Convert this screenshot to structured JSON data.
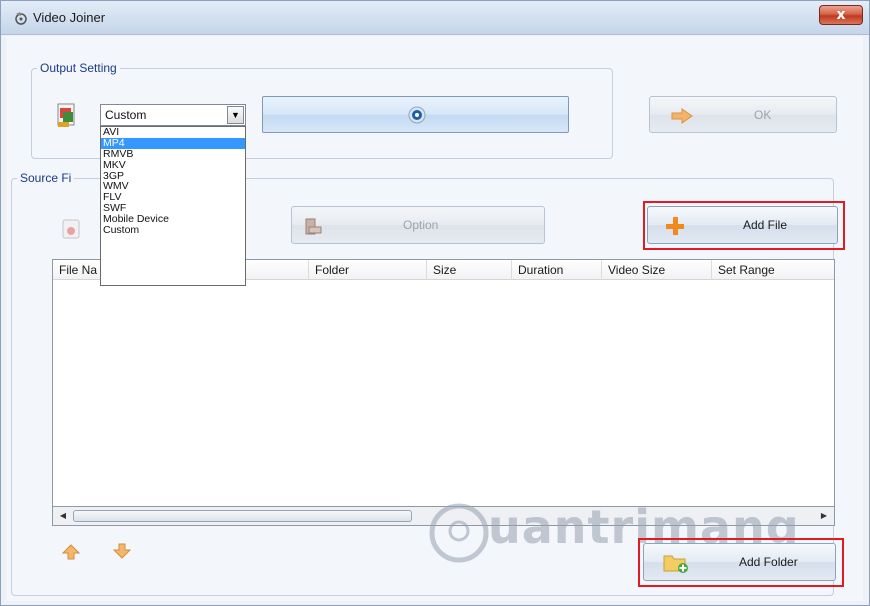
{
  "window": {
    "title": "Video Joiner",
    "close_label": "x"
  },
  "output_setting": {
    "legend": "Output Setting",
    "format_value": "Custom",
    "format_options": [
      "AVI",
      "MP4",
      "RMVB",
      "MKV",
      "3GP",
      "WMV",
      "FLV",
      "SWF",
      "Mobile Device",
      "Custom"
    ],
    "highlighted_option": "MP4",
    "ok_label": "OK"
  },
  "source_files": {
    "legend": "Source Fi",
    "option_label": "Option",
    "add_file_label": "Add File",
    "add_folder_label": "Add Folder",
    "columns": [
      "File Na",
      "Folder",
      "Size",
      "Duration",
      "Video Size",
      "Set Range"
    ]
  },
  "watermark": {
    "text": "uantrimang"
  },
  "colors": {
    "highlight_box": "#e01b24",
    "selection": "#3399ff",
    "legend_text": "#1a3a8a"
  }
}
